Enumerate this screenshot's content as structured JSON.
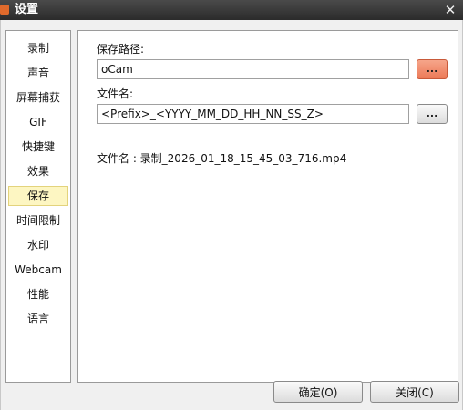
{
  "window": {
    "title": "设置",
    "close_glyph": "✕"
  },
  "sidebar": {
    "items": [
      {
        "label": "录制"
      },
      {
        "label": "声音"
      },
      {
        "label": "屏幕捕获"
      },
      {
        "label": "GIF"
      },
      {
        "label": "快捷键"
      },
      {
        "label": "效果"
      },
      {
        "label": "保存",
        "selected": true
      },
      {
        "label": "时间限制"
      },
      {
        "label": "水印"
      },
      {
        "label": "Webcam"
      },
      {
        "label": "性能"
      },
      {
        "label": "语言"
      }
    ]
  },
  "save_settings": {
    "path_label": "保存路径:",
    "path_value": "oCam",
    "path_browse_label": "...",
    "filename_label": "文件名:",
    "filename_value": "<Prefix>_<YYYY_MM_DD_HH_NN_SS_Z>",
    "filename_browse_label": "...",
    "preview_text": "文件名 : 录制_2026_01_18_15_45_03_716.mp4"
  },
  "footer": {
    "ok_label": "确定(O)",
    "close_label": "关闭(C)"
  },
  "colors": {
    "highlight_button": "#ec7a58",
    "selected_item_bg": "#fdf6c2",
    "titlebar": "#2b2b2b"
  }
}
